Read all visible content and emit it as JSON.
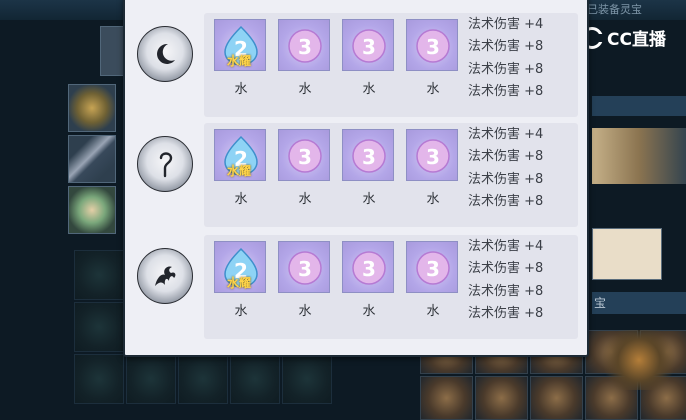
{
  "background": {
    "equipped_label": "已装备灵宝",
    "side_label": "宝"
  },
  "watermark": {
    "text": "CC直播"
  },
  "rows": [
    {
      "emblem": "crescent-moon-icon",
      "gems": [
        {
          "digit": "2",
          "tag": "水耀",
          "label": "水"
        },
        {
          "digit": "3",
          "tag": "",
          "label": "水"
        },
        {
          "digit": "3",
          "tag": "",
          "label": "水"
        },
        {
          "digit": "3",
          "tag": "",
          "label": "水"
        }
      ],
      "stats": [
        "法术伤害 +4",
        "法术伤害 +8",
        "法术伤害 +8",
        "法术伤害 +8"
      ]
    },
    {
      "emblem": "hook-staff-icon",
      "gems": [
        {
          "digit": "2",
          "tag": "水耀",
          "label": "水"
        },
        {
          "digit": "3",
          "tag": "",
          "label": "水"
        },
        {
          "digit": "3",
          "tag": "",
          "label": "水"
        },
        {
          "digit": "3",
          "tag": "",
          "label": "水"
        }
      ],
      "stats": [
        "法术伤害 +4",
        "法术伤害 +8",
        "法术伤害 +8",
        "法术伤害 +8"
      ]
    },
    {
      "emblem": "flame-swirl-icon",
      "gems": [
        {
          "digit": "2",
          "tag": "水耀",
          "label": "水"
        },
        {
          "digit": "3",
          "tag": "",
          "label": "水"
        },
        {
          "digit": "3",
          "tag": "",
          "label": "水"
        },
        {
          "digit": "3",
          "tag": "",
          "label": "水"
        }
      ],
      "stats": [
        "法术伤害 +4",
        "法术伤害 +8",
        "法术伤害 +8",
        "法术伤害 +8"
      ]
    }
  ]
}
